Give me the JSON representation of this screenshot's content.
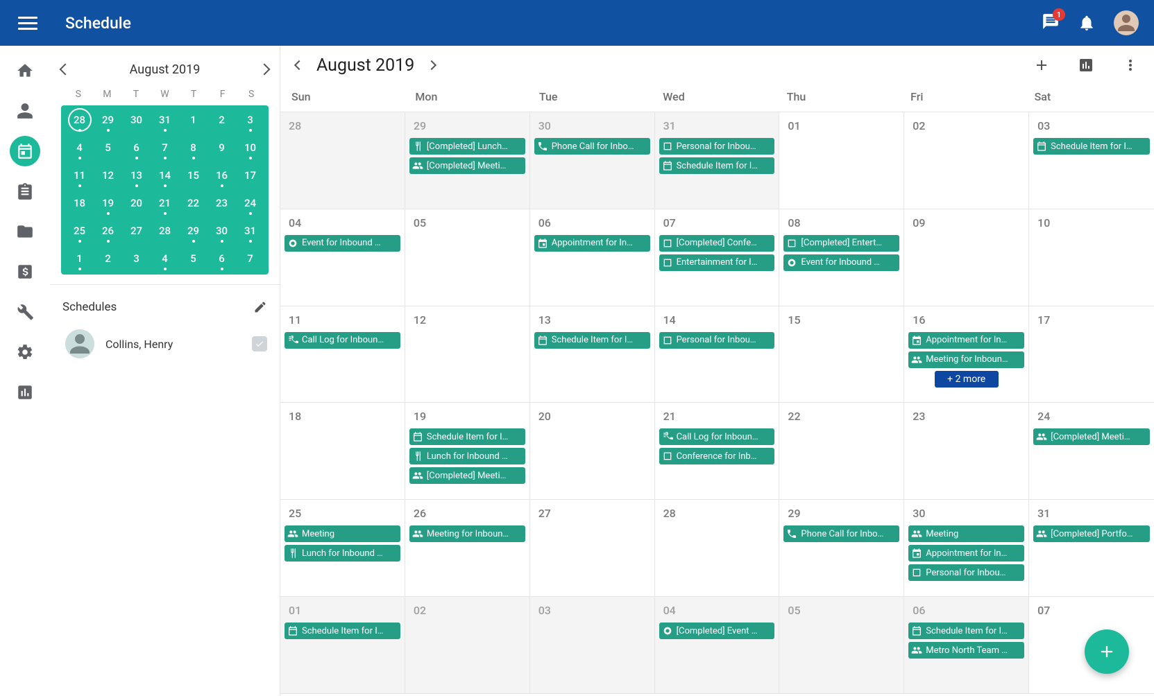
{
  "header": {
    "title": "Schedule",
    "chat_badge": "1"
  },
  "rail": {
    "items": [
      "home",
      "person",
      "calendar",
      "clipboard",
      "folder",
      "invoice",
      "wrench",
      "settings",
      "chart"
    ],
    "active": "calendar"
  },
  "mini_cal": {
    "title": "August 2019",
    "dow": [
      "S",
      "M",
      "T",
      "W",
      "T",
      "F",
      "S"
    ],
    "days": [
      {
        "n": "28",
        "dot": true,
        "today": true
      },
      {
        "n": "29",
        "dot": true
      },
      {
        "n": "30",
        "dot": false
      },
      {
        "n": "31",
        "dot": true
      },
      {
        "n": "1",
        "dot": false
      },
      {
        "n": "2",
        "dot": false
      },
      {
        "n": "3",
        "dot": true
      },
      {
        "n": "4",
        "dot": true
      },
      {
        "n": "5",
        "dot": false
      },
      {
        "n": "6",
        "dot": true
      },
      {
        "n": "7",
        "dot": true
      },
      {
        "n": "8",
        "dot": true
      },
      {
        "n": "9",
        "dot": false
      },
      {
        "n": "10",
        "dot": true
      },
      {
        "n": "11",
        "dot": true
      },
      {
        "n": "12",
        "dot": false
      },
      {
        "n": "13",
        "dot": true
      },
      {
        "n": "14",
        "dot": true
      },
      {
        "n": "15",
        "dot": false
      },
      {
        "n": "16",
        "dot": true
      },
      {
        "n": "17",
        "dot": false
      },
      {
        "n": "18",
        "dot": false
      },
      {
        "n": "19",
        "dot": true
      },
      {
        "n": "20",
        "dot": false
      },
      {
        "n": "21",
        "dot": true
      },
      {
        "n": "22",
        "dot": false
      },
      {
        "n": "23",
        "dot": false
      },
      {
        "n": "24",
        "dot": true
      },
      {
        "n": "25",
        "dot": true
      },
      {
        "n": "26",
        "dot": true
      },
      {
        "n": "27",
        "dot": false
      },
      {
        "n": "28",
        "dot": false
      },
      {
        "n": "29",
        "dot": true
      },
      {
        "n": "30",
        "dot": true
      },
      {
        "n": "31",
        "dot": true
      },
      {
        "n": "1",
        "dot": true
      },
      {
        "n": "2",
        "dot": false
      },
      {
        "n": "3",
        "dot": false
      },
      {
        "n": "4",
        "dot": true
      },
      {
        "n": "5",
        "dot": false
      },
      {
        "n": "6",
        "dot": true
      },
      {
        "n": "7",
        "dot": false
      }
    ]
  },
  "schedules": {
    "title": "Schedules",
    "items": [
      {
        "name": "Collins, Henry"
      }
    ]
  },
  "main": {
    "month": "August 2019",
    "dow": [
      "Sun",
      "Mon",
      "Tue",
      "Wed",
      "Thu",
      "Fri",
      "Sat"
    ],
    "cells": [
      {
        "date": "28",
        "muted": true,
        "events": []
      },
      {
        "date": "29",
        "muted": true,
        "events": [
          {
            "icon": "cutlery",
            "label": "[Completed] Lunch…"
          },
          {
            "icon": "group",
            "label": "[Completed] Meeti…"
          }
        ]
      },
      {
        "date": "30",
        "muted": true,
        "events": [
          {
            "icon": "phone",
            "label": "Phone Call for Inbo…"
          }
        ]
      },
      {
        "date": "31",
        "muted": true,
        "events": [
          {
            "icon": "box",
            "label": "Personal for Inbou…"
          },
          {
            "icon": "cal",
            "label": "Schedule Item for I…"
          }
        ]
      },
      {
        "date": "01",
        "muted": false,
        "events": []
      },
      {
        "date": "02",
        "muted": false,
        "events": []
      },
      {
        "date": "03",
        "muted": false,
        "events": [
          {
            "icon": "cal",
            "label": "Schedule Item for I…"
          }
        ]
      },
      {
        "date": "04",
        "muted": false,
        "events": [
          {
            "icon": "circle",
            "label": "Event for Inbound …"
          }
        ]
      },
      {
        "date": "05",
        "muted": false,
        "events": []
      },
      {
        "date": "06",
        "muted": false,
        "events": [
          {
            "icon": "appt",
            "label": "Appointment for In…"
          }
        ]
      },
      {
        "date": "07",
        "muted": false,
        "events": [
          {
            "icon": "box",
            "label": "[Completed] Confe…"
          },
          {
            "icon": "box",
            "label": "Entertainment for I…"
          }
        ]
      },
      {
        "date": "08",
        "muted": false,
        "events": [
          {
            "icon": "box",
            "label": "[Completed] Entert…"
          },
          {
            "icon": "circle",
            "label": "Event for Inbound …"
          }
        ]
      },
      {
        "date": "09",
        "muted": false,
        "events": []
      },
      {
        "date": "10",
        "muted": false,
        "events": []
      },
      {
        "date": "11",
        "muted": false,
        "events": [
          {
            "icon": "calllog",
            "label": "Call Log for Inboun…"
          }
        ]
      },
      {
        "date": "12",
        "muted": false,
        "events": []
      },
      {
        "date": "13",
        "muted": false,
        "events": [
          {
            "icon": "cal",
            "label": "Schedule Item for I…"
          }
        ]
      },
      {
        "date": "14",
        "muted": false,
        "events": [
          {
            "icon": "box",
            "label": "Personal for Inbou…"
          }
        ]
      },
      {
        "date": "15",
        "muted": false,
        "events": []
      },
      {
        "date": "16",
        "muted": false,
        "events": [
          {
            "icon": "appt",
            "label": "Appointment for In…"
          },
          {
            "icon": "group",
            "label": "Meeting for Inboun…"
          }
        ],
        "more": "+ 2 more"
      },
      {
        "date": "17",
        "muted": false,
        "events": []
      },
      {
        "date": "18",
        "muted": false,
        "events": []
      },
      {
        "date": "19",
        "muted": false,
        "events": [
          {
            "icon": "cal",
            "label": "Schedule Item for I…"
          },
          {
            "icon": "cutlery",
            "label": "Lunch for Inbound …"
          },
          {
            "icon": "group",
            "label": "[Completed] Meeti…"
          }
        ]
      },
      {
        "date": "20",
        "muted": false,
        "events": []
      },
      {
        "date": "21",
        "muted": false,
        "events": [
          {
            "icon": "calllog",
            "label": "Call Log for Inboun…"
          },
          {
            "icon": "box",
            "label": "Conference for Inb…"
          }
        ]
      },
      {
        "date": "22",
        "muted": false,
        "events": []
      },
      {
        "date": "23",
        "muted": false,
        "events": []
      },
      {
        "date": "24",
        "muted": false,
        "events": [
          {
            "icon": "group",
            "label": "[Completed] Meeti…"
          }
        ]
      },
      {
        "date": "25",
        "muted": false,
        "events": [
          {
            "icon": "group",
            "label": "Meeting"
          },
          {
            "icon": "cutlery",
            "label": "Lunch for Inbound …"
          }
        ]
      },
      {
        "date": "26",
        "muted": false,
        "events": [
          {
            "icon": "group",
            "label": "Meeting for Inboun…"
          }
        ]
      },
      {
        "date": "27",
        "muted": false,
        "events": []
      },
      {
        "date": "28",
        "muted": false,
        "events": []
      },
      {
        "date": "29",
        "muted": false,
        "events": [
          {
            "icon": "phone",
            "label": "Phone Call for Inbo…"
          }
        ]
      },
      {
        "date": "30",
        "muted": false,
        "events": [
          {
            "icon": "group",
            "label": "Meeting"
          },
          {
            "icon": "appt",
            "label": "Appointment for In…"
          },
          {
            "icon": "box",
            "label": "Personal for Inbou…"
          }
        ]
      },
      {
        "date": "31",
        "muted": false,
        "events": [
          {
            "icon": "group",
            "label": "[Completed] Portfo…"
          }
        ]
      },
      {
        "date": "01",
        "muted": true,
        "events": [
          {
            "icon": "cal",
            "label": "Schedule Item for I…"
          }
        ]
      },
      {
        "date": "02",
        "muted": true,
        "events": []
      },
      {
        "date": "03",
        "muted": true,
        "events": []
      },
      {
        "date": "04",
        "muted": true,
        "events": [
          {
            "icon": "circle",
            "label": "[Completed] Event …"
          }
        ]
      },
      {
        "date": "05",
        "muted": true,
        "events": []
      },
      {
        "date": "06",
        "muted": true,
        "events": [
          {
            "icon": "cal",
            "label": "Schedule Item for I…"
          },
          {
            "icon": "group",
            "label": "Metro North Team …"
          }
        ]
      },
      {
        "date": "07",
        "muted": false,
        "events": []
      }
    ]
  }
}
